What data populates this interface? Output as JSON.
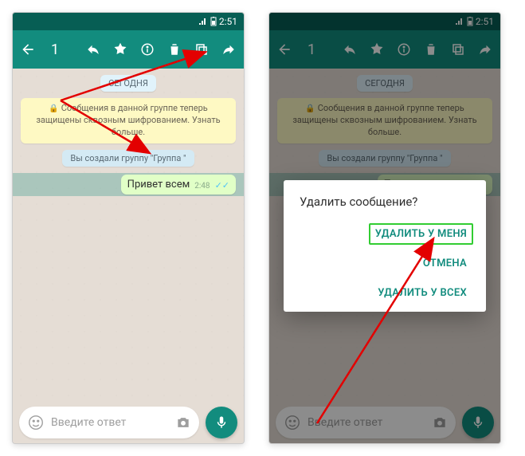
{
  "status": {
    "time": "2:51"
  },
  "appbar": {
    "selection_count": "1"
  },
  "chat": {
    "date": "СЕГОДНЯ",
    "encryption_notice": "Сообщения в данной группе теперь защищены сквозным шифрованием. Узнать больше.",
    "system_msg": "Вы создали группу \"Группа \"",
    "message": {
      "text": "Привет всем",
      "time": "2:48"
    }
  },
  "input": {
    "placeholder": "Введите ответ"
  },
  "dialog": {
    "title": "Удалить сообщение?",
    "delete_for_me": "УДАЛИТЬ У МЕНЯ",
    "cancel": "ОТМЕНА",
    "delete_for_all": "УДАЛИТЬ У ВСЕХ"
  }
}
